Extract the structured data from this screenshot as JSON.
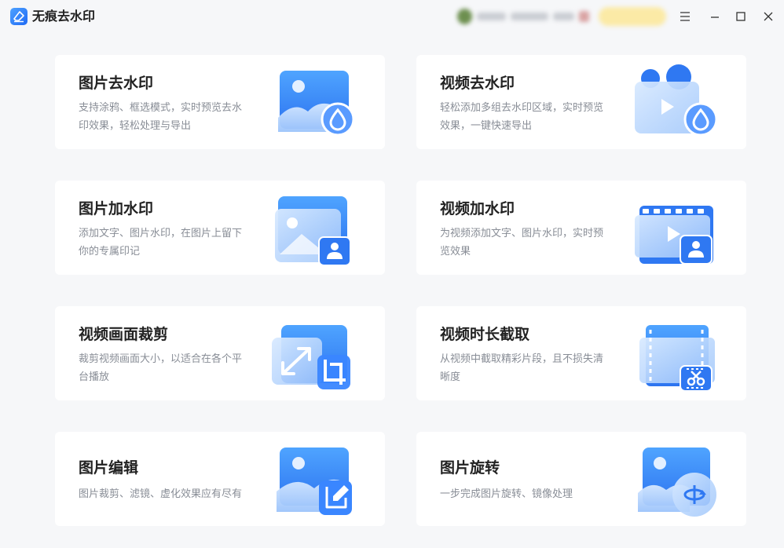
{
  "app": {
    "title": "无痕去水印",
    "icon": "eraser-logo-icon"
  },
  "window_controls": [
    "menu-icon",
    "minimize-icon",
    "maximize-icon",
    "close-icon"
  ],
  "colors": {
    "accent": "#3a86ff",
    "card_bg": "#ffffff",
    "page_bg": "#f6f7f9",
    "title_text": "#222222",
    "desc_text": "#888d96"
  },
  "features": [
    {
      "title": "图片去水印",
      "desc_lines": [
        "支持涂鸦、框选模式，实时预览去水",
        "印效果，轻松处理与导出"
      ],
      "icon": "image-watermark-remove-icon"
    },
    {
      "title": "视频去水印",
      "desc_lines": [
        "轻松添加多组去水印区域，实时预览",
        "效果，一键快速导出"
      ],
      "icon": "video-watermark-remove-icon"
    },
    {
      "title": "图片加水印",
      "desc_lines": [
        "添加文字、图片水印，在图片上留下",
        "你的专属印记"
      ],
      "icon": "image-watermark-add-icon"
    },
    {
      "title": "视频加水印",
      "desc_lines": [
        "为视频添加文字、图片水印，实时预",
        "览效果"
      ],
      "icon": "video-watermark-add-icon"
    },
    {
      "title": "视频画面裁剪",
      "desc_lines": [
        "裁剪视频画面大小，以适合在各个平",
        "台播放"
      ],
      "icon": "video-crop-icon"
    },
    {
      "title": "视频时长截取",
      "desc_lines": [
        "从视频中截取精彩片段，且不损失清",
        "晰度"
      ],
      "icon": "video-trim-icon"
    },
    {
      "title": "图片编辑",
      "desc_lines": [
        "图片裁剪、滤镜、虚化效果应有尽有"
      ],
      "icon": "image-edit-icon"
    },
    {
      "title": "图片旋转",
      "desc_lines": [
        "一步完成图片旋转、镜像处理"
      ],
      "icon": "image-rotate-icon"
    }
  ]
}
